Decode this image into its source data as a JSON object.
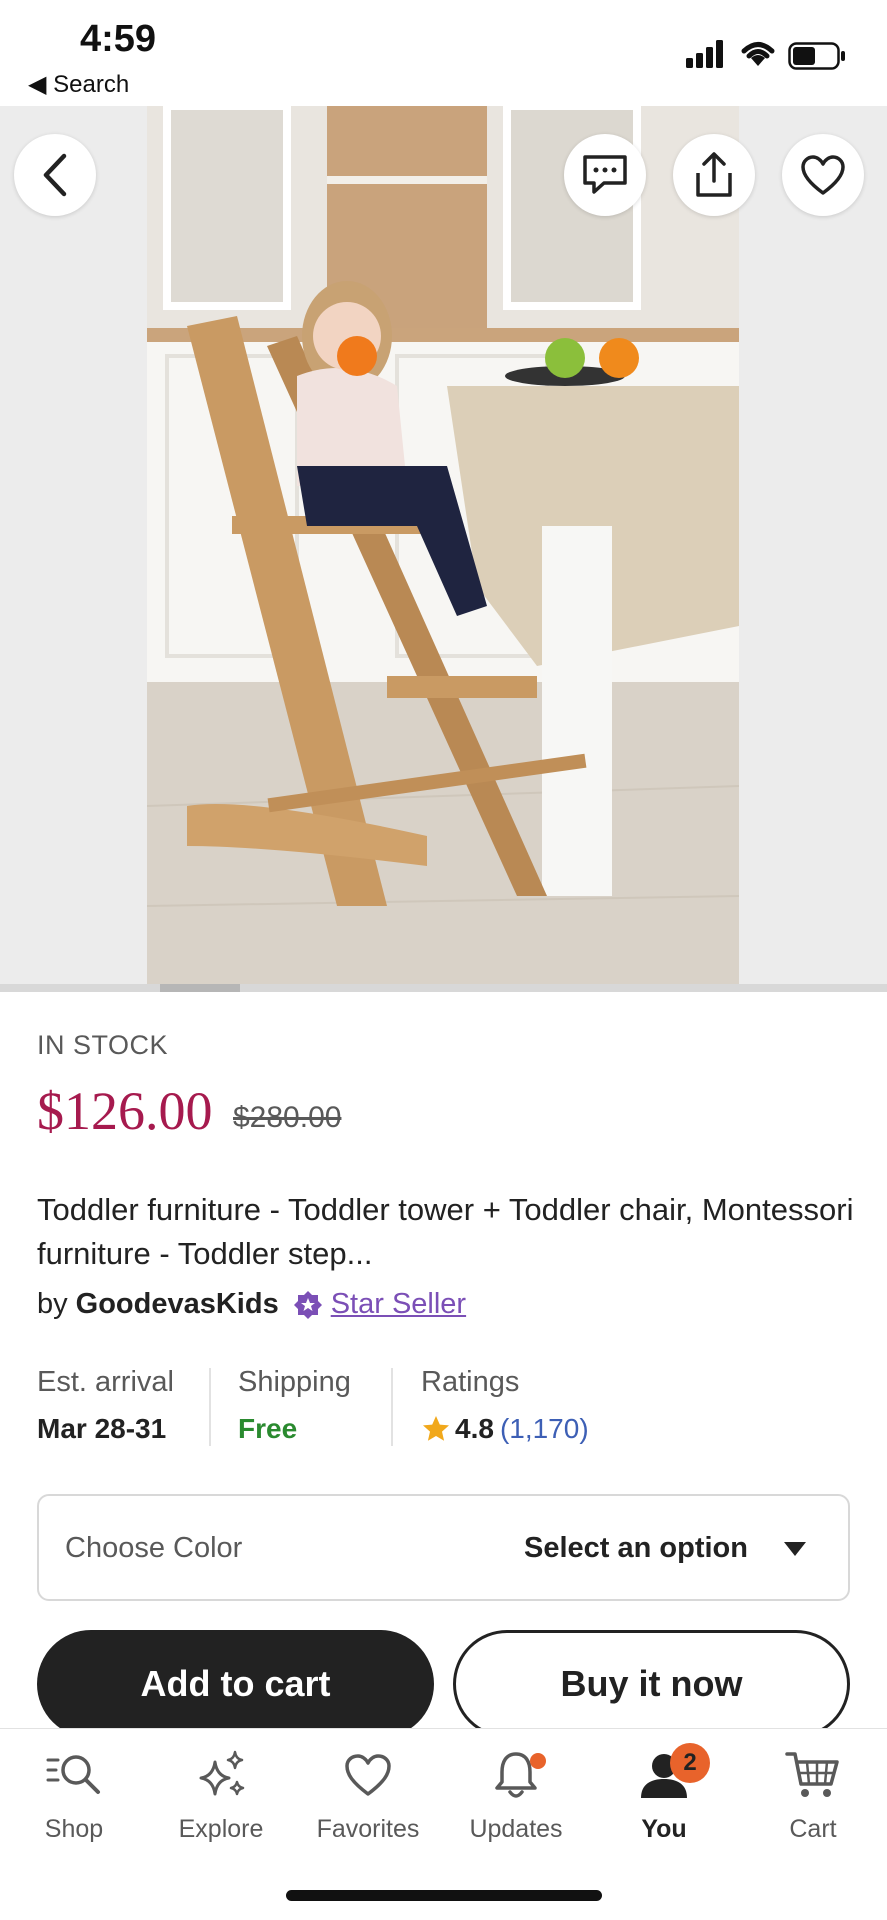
{
  "status_bar": {
    "time": "4:59",
    "back_label": "◀ Search"
  },
  "product": {
    "stock": "IN STOCK",
    "price": "$126.00",
    "original_price": "$280.00",
    "title": "Toddler furniture - Toddler tower + Toddler chair, Montessori furniture - Toddler step...",
    "seller_prefix": "by",
    "seller_name": "GoodevasKids",
    "star_seller_label": "Star Seller"
  },
  "stats": {
    "arrival_label": "Est. arrival",
    "arrival_value": "Mar 28-31",
    "shipping_label": "Shipping",
    "shipping_value": "Free",
    "ratings_label": "Ratings",
    "rating_value": "4.8",
    "rating_count": "(1,170)"
  },
  "variation": {
    "label": "Choose Color",
    "value": "Select an option"
  },
  "actions": {
    "add_to_cart": "Add to cart",
    "buy_now": "Buy it now"
  },
  "tabs": [
    {
      "label": "Shop",
      "icon": "search-icon"
    },
    {
      "label": "Explore",
      "icon": "sparkle-icon"
    },
    {
      "label": "Favorites",
      "icon": "heart-icon"
    },
    {
      "label": "Updates",
      "icon": "bell-icon"
    },
    {
      "label": "You",
      "icon": "person-icon",
      "badge": "2"
    },
    {
      "label": "Cart",
      "icon": "cart-icon"
    }
  ],
  "colors": {
    "price": "#a61a4e",
    "star_seller": "#7b4fb6",
    "free": "#2a8a2f",
    "badge": "#e8632b",
    "rating_count": "#3d5fb5"
  }
}
